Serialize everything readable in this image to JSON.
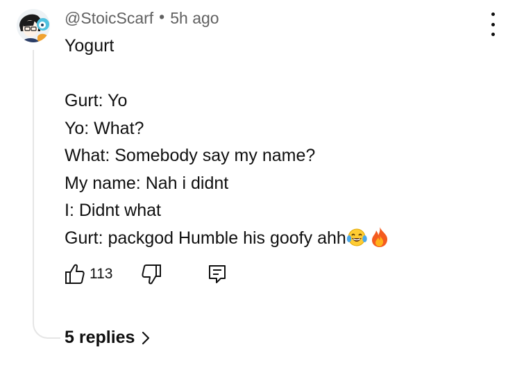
{
  "comment": {
    "author": "@StoicScarf",
    "time": "5h ago",
    "lines": [
      "Yogurt",
      "",
      "Gurt: Yo",
      "Yo: What?",
      "What: Somebody say my name?",
      "My name: Nah i didnt",
      "I: Didnt what",
      "Gurt: packgod Humble his goofy ahh"
    ],
    "emojis": [
      "face-with-tears-of-joy-emoji",
      "fire-emoji"
    ]
  },
  "actions": {
    "like_count": "113",
    "icons": [
      "thumbs-up-icon",
      "thumbs-down-icon",
      "reply-comment-icon"
    ]
  },
  "replies": {
    "label": "5 replies"
  },
  "colors": {
    "text": "#0f0f0f",
    "meta": "#606060",
    "thread_line": "#e5e5e5"
  }
}
